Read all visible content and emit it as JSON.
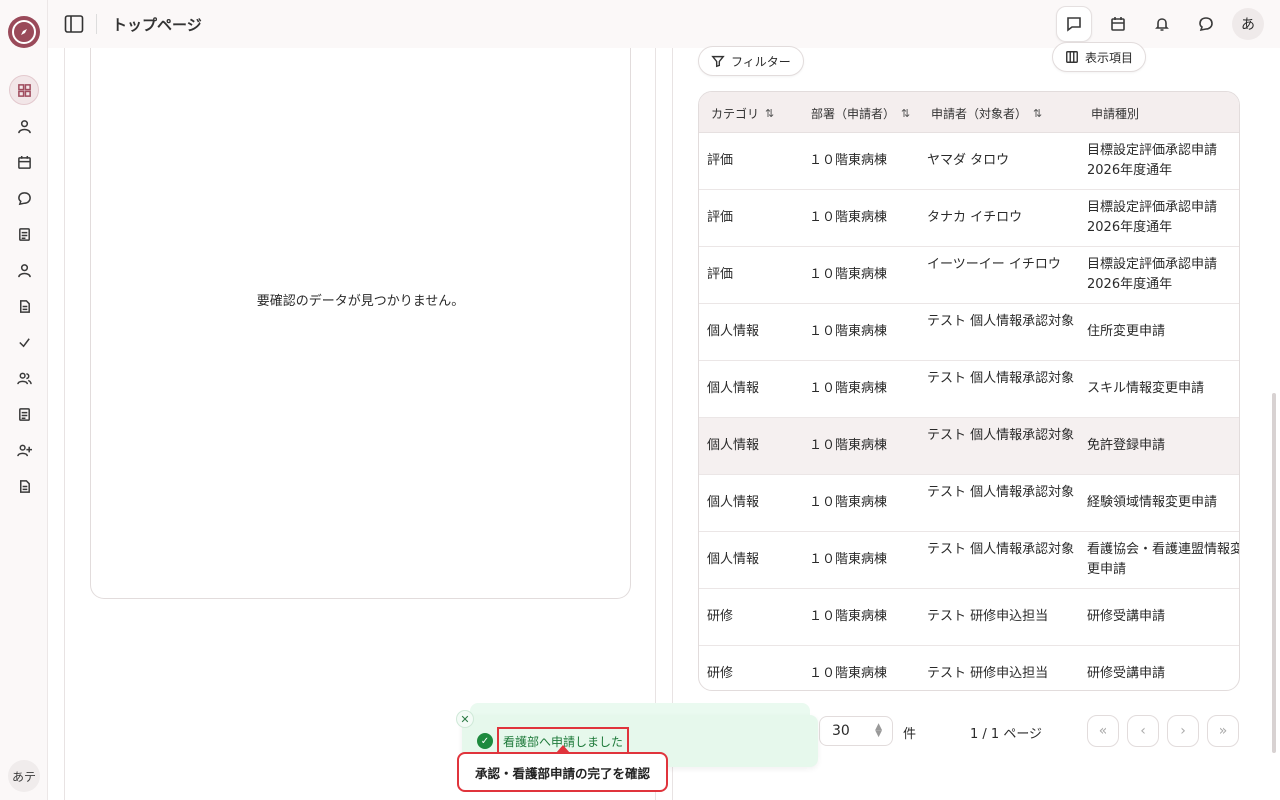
{
  "header": {
    "title": "トップページ",
    "user_initial": "あ"
  },
  "sidebar": {
    "items": [
      {
        "icon": "dashboard-icon"
      },
      {
        "icon": "user-icon"
      },
      {
        "icon": "calendar-icon"
      },
      {
        "icon": "chat-icon"
      },
      {
        "icon": "list-icon"
      },
      {
        "icon": "person-icon"
      },
      {
        "icon": "document-icon"
      },
      {
        "icon": "check-icon"
      },
      {
        "icon": "users-icon"
      },
      {
        "icon": "notes-icon"
      },
      {
        "icon": "add-user-icon"
      },
      {
        "icon": "file-icon"
      }
    ],
    "user_label": "あテ"
  },
  "left_panel": {
    "empty_message": "要確認のデータが見つかりません。"
  },
  "right_panel": {
    "filter_label": "フィルター",
    "columns_label": "表示項目",
    "table": {
      "headers": [
        "カテゴリ",
        "部署（申請者）",
        "申請者（対象者）",
        "申請種別"
      ],
      "rows": [
        {
          "category": "評価",
          "dept": "１０階東病棟",
          "applicant": "ヤマダ タロウ",
          "type": "目標設定評価承認申請 2026年度通年"
        },
        {
          "category": "評価",
          "dept": "１０階東病棟",
          "applicant": "タナカ イチロウ",
          "type": "目標設定評価承認申請 2026年度通年"
        },
        {
          "category": "評価",
          "dept": "１０階東病棟",
          "applicant": "イーツーイー イチロウ",
          "type": "目標設定評価承認申請 2026年度通年"
        },
        {
          "category": "個人情報",
          "dept": "１０階東病棟",
          "applicant": "テスト 個人情報承認対象",
          "type": "住所変更申請"
        },
        {
          "category": "個人情報",
          "dept": "１０階東病棟",
          "applicant": "テスト 個人情報承認対象",
          "type": "スキル情報変更申請"
        },
        {
          "category": "個人情報",
          "dept": "１０階東病棟",
          "applicant": "テスト 個人情報承認対象",
          "type": "免許登録申請"
        },
        {
          "category": "個人情報",
          "dept": "１０階東病棟",
          "applicant": "テスト 個人情報承認対象",
          "type": "経験領域情報変更申請"
        },
        {
          "category": "個人情報",
          "dept": "１０階東病棟",
          "applicant": "テスト 個人情報承認対象",
          "type": "看護協会・看護連盟情報変更申請"
        },
        {
          "category": "研修",
          "dept": "１０階東病棟",
          "applicant": "テスト 研修申込担当",
          "type": "研修受講申請"
        },
        {
          "category": "研修",
          "dept": "１０階東病棟",
          "applicant": "テスト 研修申込担当",
          "type": "研修受講申請"
        }
      ]
    },
    "pager": {
      "per_page": "30",
      "unit": "件",
      "page_info": "1 / 1 ページ"
    }
  },
  "toast": {
    "message": "看護部へ申請しました",
    "callout": "承認・看護部申請の完了を確認"
  },
  "colors": {
    "brand": "#9a4a5a",
    "success": "#1e8a3e",
    "highlight_border": "#e0343c"
  }
}
